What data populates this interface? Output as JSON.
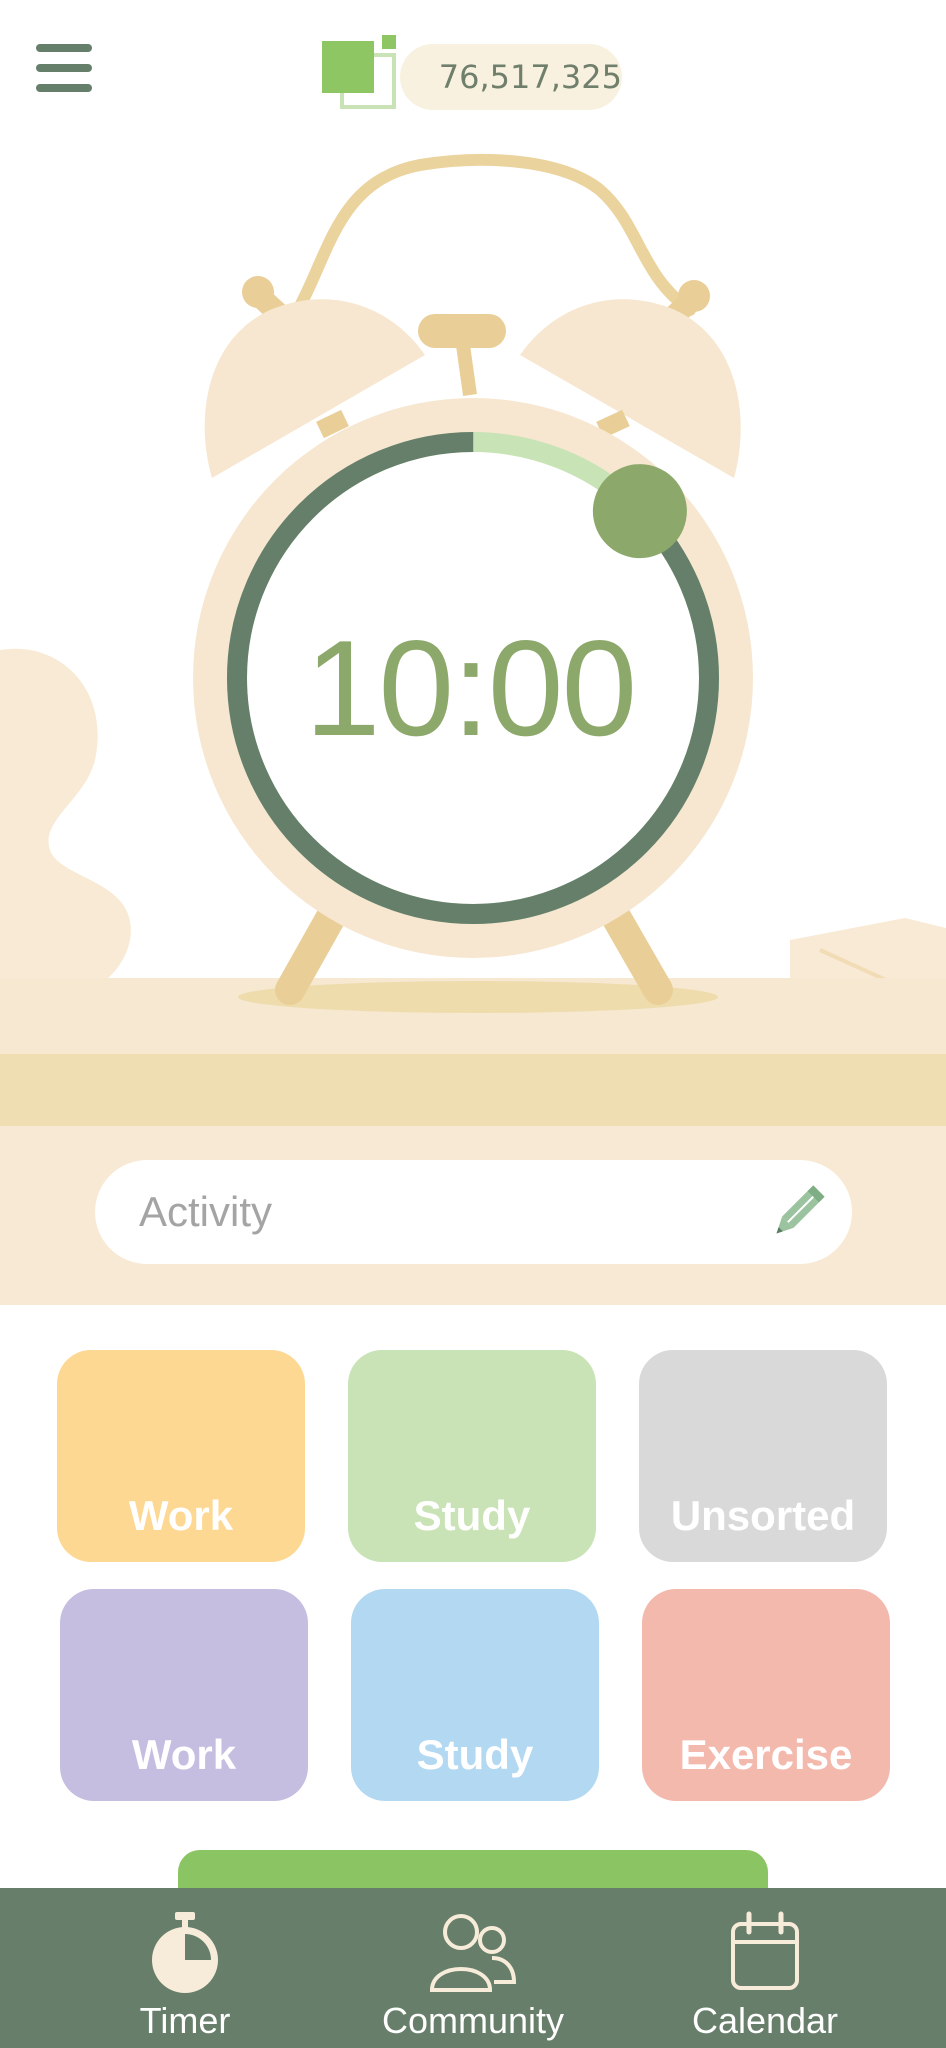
{
  "header": {
    "coin_balance": "76,517,325",
    "menu_icon": "hamburger-menu-icon",
    "coin_icon": "coin-squares-icon"
  },
  "timer": {
    "time": "10:00",
    "progress_fraction": 0.125,
    "ring_track_color": "#c8e3b6",
    "ring_fill_color": "#667f6a",
    "knob_color": "#8ca86a"
  },
  "activity": {
    "placeholder": "Activity",
    "edit_icon": "pencil-icon"
  },
  "categories": [
    {
      "label": "Work",
      "color": "#fdd892"
    },
    {
      "label": "Study",
      "color": "#c9e3b7"
    },
    {
      "label": "Unsorted",
      "color": "#d9d9d9"
    },
    {
      "label": "Work",
      "color": "#c5bee0"
    },
    {
      "label": "Study",
      "color": "#b3d8f1"
    },
    {
      "label": "Exercise",
      "color": "#f4b9ad"
    }
  ],
  "nav": [
    {
      "label": "Timer",
      "icon": "stopwatch-icon"
    },
    {
      "label": "Community",
      "icon": "people-icon"
    },
    {
      "label": "Calendar",
      "icon": "calendar-icon"
    }
  ]
}
